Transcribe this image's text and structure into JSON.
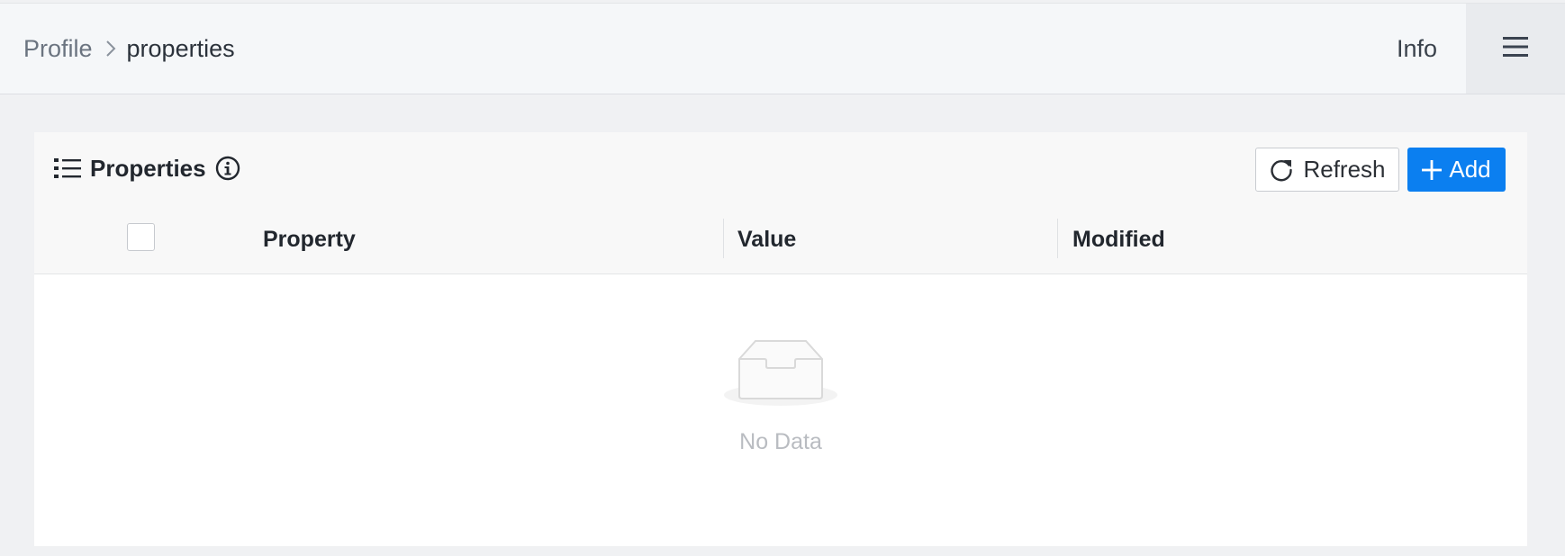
{
  "header": {
    "breadcrumb": [
      {
        "label": "Profile"
      },
      {
        "label": "properties"
      }
    ],
    "info_label": "Info",
    "menu_icon": "hamburger-menu-icon"
  },
  "panel": {
    "title": "Properties",
    "title_icon": "list-icon",
    "info_icon": "info-circle-icon",
    "refresh_label": "Refresh",
    "add_label": "Add"
  },
  "table": {
    "columns": [
      "Property",
      "Value",
      "Modified"
    ],
    "rows": [],
    "empty_text": "No Data"
  },
  "colors": {
    "accent": "#0b7ff0",
    "page_bg": "#f0f1f3"
  }
}
